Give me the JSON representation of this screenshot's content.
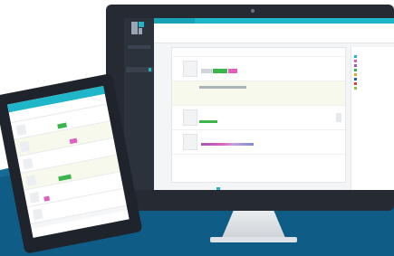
{
  "colors": {
    "accent": "#20b6c9",
    "sidebar": "#2c323c",
    "device_frame": "#252a33",
    "wave": "#0f5d86",
    "highlight_row": "#f7f9ec"
  },
  "monitor": {
    "app_name": "",
    "header_title": "",
    "nav": [
      "",
      "",
      "",
      ""
    ],
    "list_header": "",
    "rows": [
      {
        "title": "",
        "subtitle": ""
      },
      {
        "title": "",
        "subtitle": ""
      },
      {
        "title": "",
        "subtitle": ""
      },
      {
        "title": "",
        "subtitle": ""
      }
    ],
    "pager": "",
    "filter_header": "",
    "filters": [
      "",
      "",
      "",
      "",
      "",
      "",
      "",
      ""
    ]
  },
  "tablet": {
    "header_title": "",
    "rows": [
      "",
      "",
      "",
      "",
      "",
      ""
    ],
    "footer": ""
  },
  "icons": [
    "app-logo-icon",
    "camera-icon"
  ]
}
